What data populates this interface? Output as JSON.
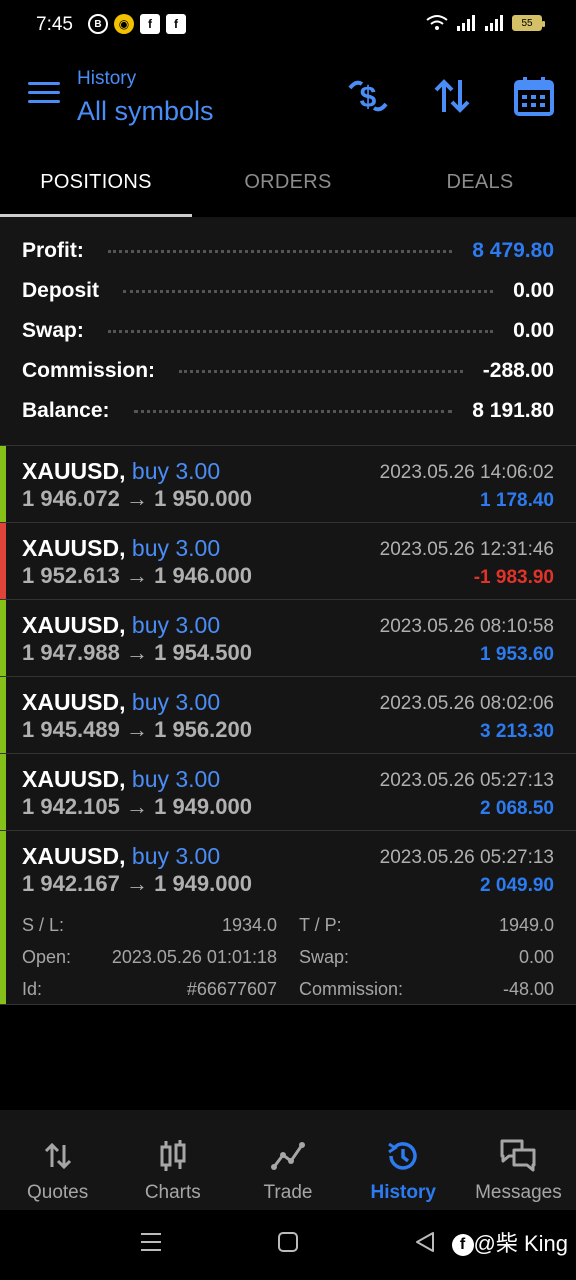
{
  "status_bar": {
    "time": "7:45",
    "battery": "55"
  },
  "header": {
    "subtitle": "History",
    "title": "All symbols"
  },
  "tabs": [
    {
      "label": "POSITIONS",
      "active": true
    },
    {
      "label": "ORDERS",
      "active": false
    },
    {
      "label": "DEALS",
      "active": false
    }
  ],
  "summary": {
    "profit_label": "Profit:",
    "profit": "8 479.80",
    "deposit_label": "Deposit",
    "deposit": "0.00",
    "swap_label": "Swap:",
    "swap": "0.00",
    "commission_label": "Commission:",
    "commission": "-288.00",
    "balance_label": "Balance:",
    "balance": "8 191.80"
  },
  "deals": [
    {
      "symbol": "XAUUSD,",
      "side": "buy 3.00",
      "prices": "1 946.072 → 1 950.000",
      "time": "2023.05.26 14:06:02",
      "profit": "1 178.40",
      "loss": false
    },
    {
      "symbol": "XAUUSD,",
      "side": "buy 3.00",
      "prices": "1 952.613 → 1 946.000",
      "time": "2023.05.26 12:31:46",
      "profit": "-1 983.90",
      "loss": true
    },
    {
      "symbol": "XAUUSD,",
      "side": "buy 3.00",
      "prices": "1 947.988 → 1 954.500",
      "time": "2023.05.26 08:10:58",
      "profit": "1 953.60",
      "loss": false
    },
    {
      "symbol": "XAUUSD,",
      "side": "buy 3.00",
      "prices": "1 945.489 → 1 956.200",
      "time": "2023.05.26 08:02:06",
      "profit": "3 213.30",
      "loss": false
    },
    {
      "symbol": "XAUUSD,",
      "side": "buy 3.00",
      "prices": "1 942.105 → 1 949.000",
      "time": "2023.05.26 05:27:13",
      "profit": "2 068.50",
      "loss": false
    },
    {
      "symbol": "XAUUSD,",
      "side": "buy 3.00",
      "prices": "1 942.167 → 1 949.000",
      "time": "2023.05.26 05:27:13",
      "profit": "2 049.90",
      "loss": false
    }
  ],
  "details": {
    "sl_label": "S / L:",
    "sl": "1934.0",
    "tp_label": "T / P:",
    "tp": "1949.0",
    "open_label": "Open:",
    "open": "2023.05.26 01:01:18",
    "swap_label": "Swap:",
    "swap": "0.00",
    "id_label": "Id:",
    "id": "#66677607",
    "commission_label": "Commission:",
    "commission": "-48.00"
  },
  "bottom_nav": [
    {
      "label": "Quotes",
      "icon": "quotes-icon"
    },
    {
      "label": "Charts",
      "icon": "charts-icon"
    },
    {
      "label": "Trade",
      "icon": "trade-icon"
    },
    {
      "label": "History",
      "icon": "history-icon",
      "active": true
    },
    {
      "label": "Messages",
      "icon": "messages-icon"
    }
  ],
  "watermark": "@柴 King",
  "colors": {
    "accent": "#2d7bf0",
    "profit_bar": "#86c11a",
    "loss_bar": "#e04438",
    "loss_text": "#e0342b"
  }
}
